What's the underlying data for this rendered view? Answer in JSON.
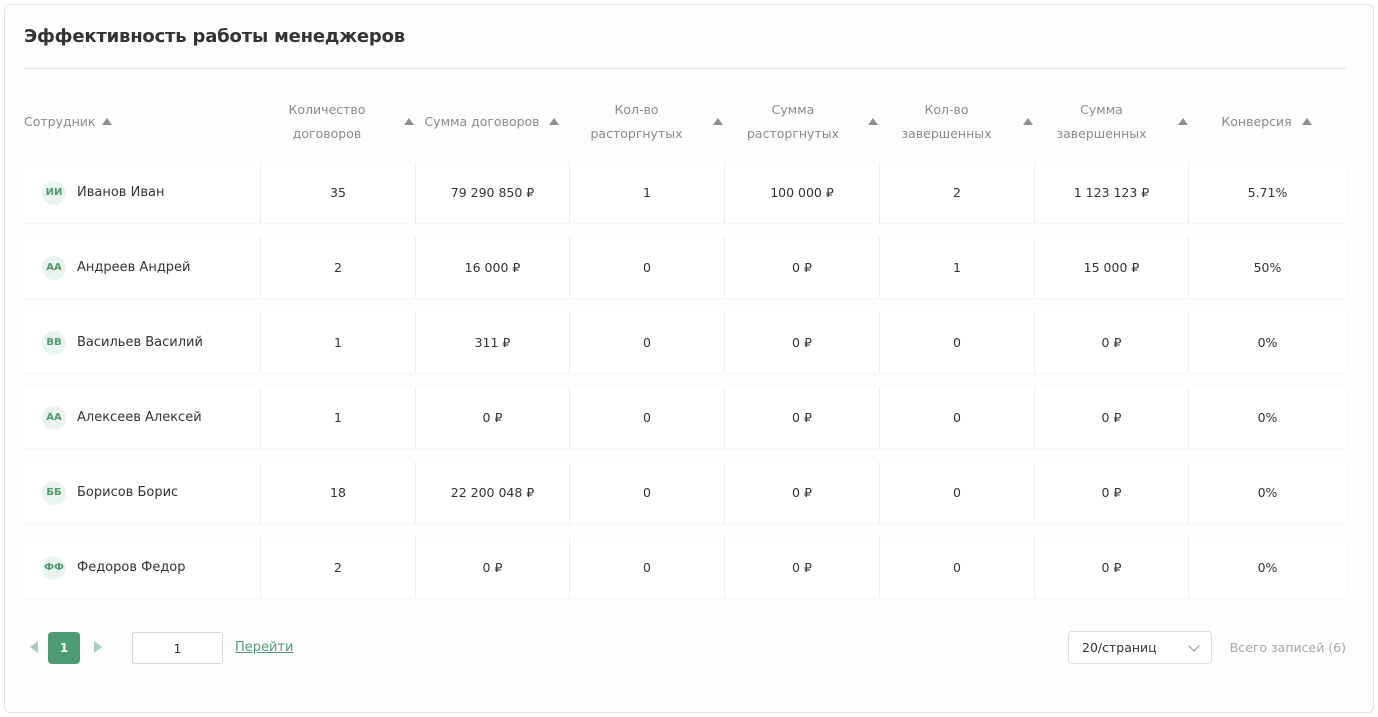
{
  "title": "Эффективность работы менеджеров",
  "columns": [
    {
      "l1": "Сотрудник",
      "l2": ""
    },
    {
      "l1": "Количество",
      "l2": "договоров"
    },
    {
      "l1": "Сумма договоров",
      "l2": ""
    },
    {
      "l1": "Кол-во",
      "l2": "расторгнутых"
    },
    {
      "l1": "Сумма расторгнутых",
      "l2": ""
    },
    {
      "l1": "Кол-во",
      "l2": "завершенных"
    },
    {
      "l1": "Сумма",
      "l2": "завершенных"
    },
    {
      "l1": "Конверсия",
      "l2": ""
    }
  ],
  "rows": [
    {
      "initials": "ИИ",
      "name": "Иванов Иван",
      "contracts": "35",
      "contracts_sum": "79 290 850 ₽",
      "terminated": "1",
      "terminated_sum": "100 000 ₽",
      "completed": "2",
      "completed_sum": "1 123 123 ₽",
      "conversion": "5.71%"
    },
    {
      "initials": "АА",
      "name": "Андреев Андрей",
      "contracts": "2",
      "contracts_sum": "16 000 ₽",
      "terminated": "0",
      "terminated_sum": "0 ₽",
      "completed": "1",
      "completed_sum": "15 000 ₽",
      "conversion": "50%"
    },
    {
      "initials": "ВВ",
      "name": "Васильев Василий",
      "contracts": "1",
      "contracts_sum": "311 ₽",
      "terminated": "0",
      "terminated_sum": "0 ₽",
      "completed": "0",
      "completed_sum": "0 ₽",
      "conversion": "0%"
    },
    {
      "initials": "АА",
      "name": "Алексеев Алексей",
      "contracts": "1",
      "contracts_sum": "0 ₽",
      "terminated": "0",
      "terminated_sum": "0 ₽",
      "completed": "0",
      "completed_sum": "0 ₽",
      "conversion": "0%"
    },
    {
      "initials": "ББ",
      "name": "Борисов Борис",
      "contracts": "18",
      "contracts_sum": "22 200 048 ₽",
      "terminated": "0",
      "terminated_sum": "0 ₽",
      "completed": "0",
      "completed_sum": "0 ₽",
      "conversion": "0%"
    },
    {
      "initials": "ФФ",
      "name": "Федоров Федор",
      "contracts": "2",
      "contracts_sum": "0 ₽",
      "terminated": "0",
      "terminated_sum": "0 ₽",
      "completed": "0",
      "completed_sum": "0 ₽",
      "conversion": "0%"
    }
  ],
  "pagination": {
    "current_page": "1",
    "goto_value": "1",
    "goto_label": "Перейти",
    "per_page": "20/страниц",
    "total": "Всего записей (6)"
  },
  "colors": {
    "accent": "#4e9b71",
    "avatar_bg": "#eaf4ee"
  }
}
